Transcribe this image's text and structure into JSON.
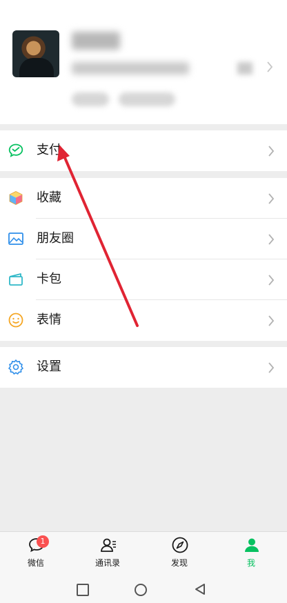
{
  "menu": {
    "pay": {
      "label": "支付",
      "icon": "wechat-pay-icon"
    },
    "favorites": {
      "label": "收藏",
      "icon": "favorites-cube-icon"
    },
    "moments": {
      "label": "朋友圈",
      "icon": "moments-picture-icon"
    },
    "cards": {
      "label": "卡包",
      "icon": "card-wallet-icon"
    },
    "stickers": {
      "label": "表情",
      "icon": "smiley-icon"
    },
    "settings": {
      "label": "设置",
      "icon": "gear-icon"
    }
  },
  "tabs": [
    {
      "label": "微信",
      "icon": "chat-bubble-icon",
      "badge": "1",
      "active": false
    },
    {
      "label": "通讯录",
      "icon": "contacts-icon",
      "active": false
    },
    {
      "label": "发现",
      "icon": "compass-icon",
      "active": false
    },
    {
      "label": "我",
      "icon": "person-icon",
      "active": true
    }
  ],
  "colors": {
    "accent": "#07c160",
    "badge": "#fa5151",
    "annotation_arrow": "#e02433"
  }
}
